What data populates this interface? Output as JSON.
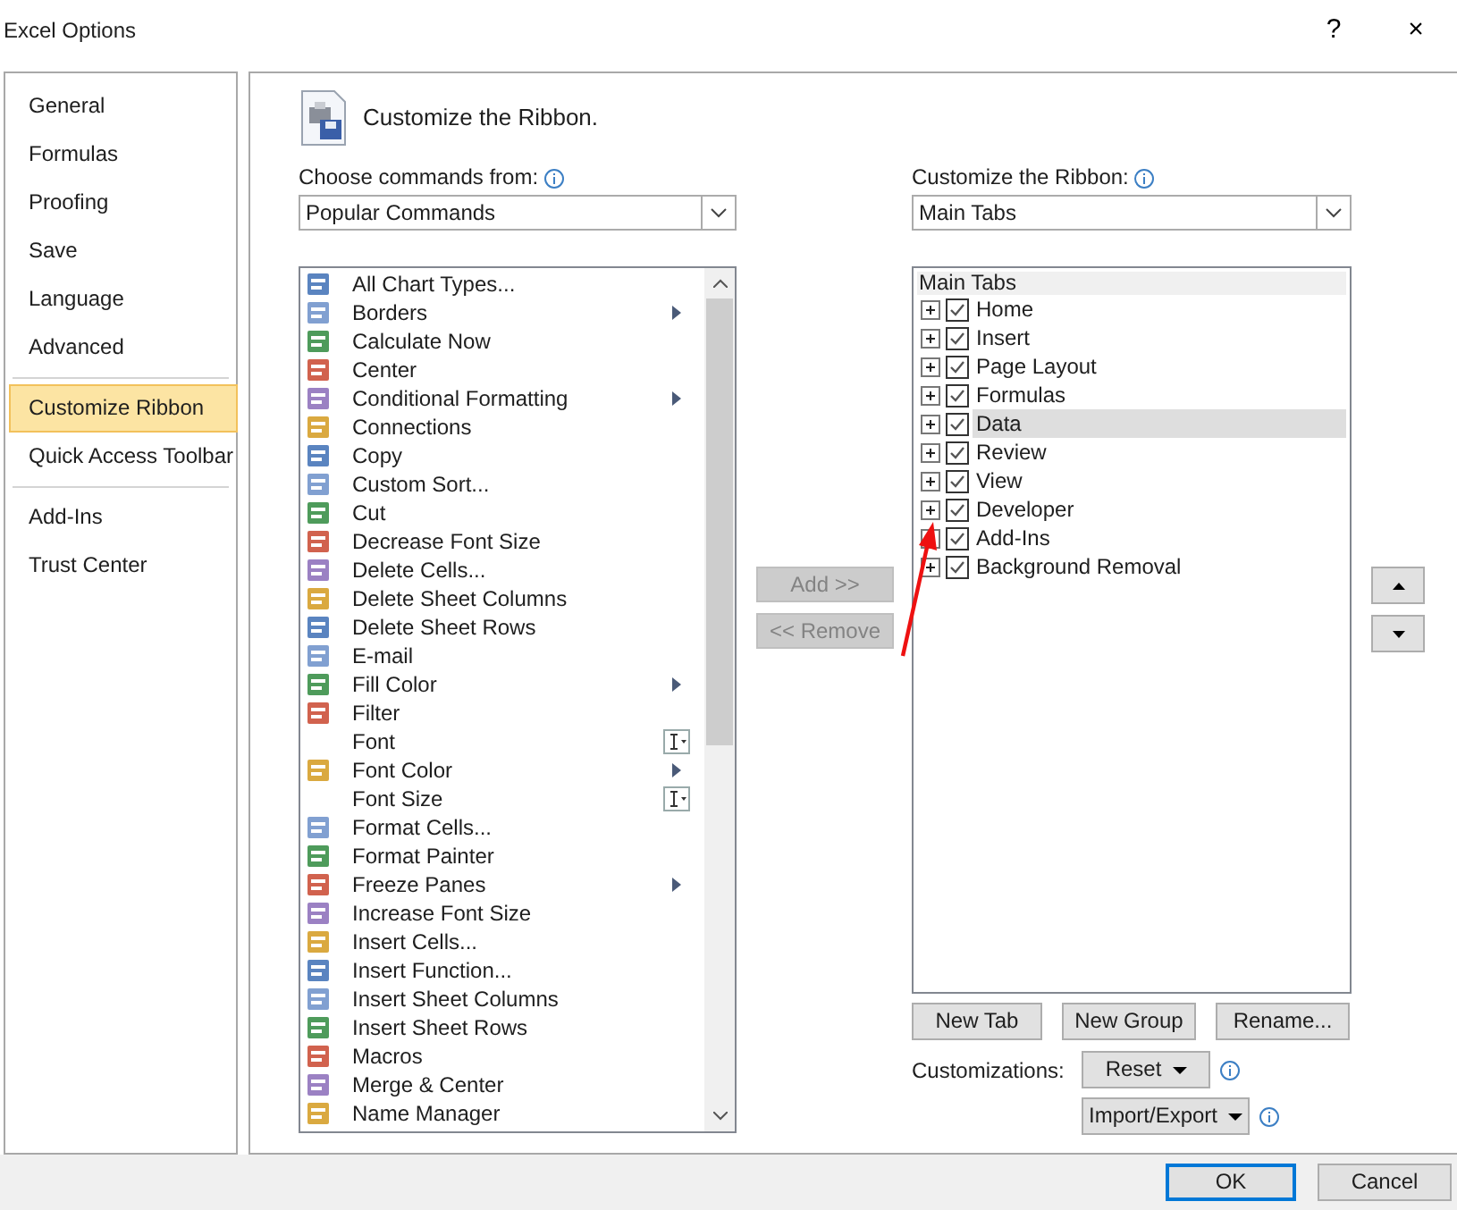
{
  "window": {
    "title": "Excel Options",
    "help": "?",
    "close": "×"
  },
  "sidebar": {
    "groups": [
      [
        {
          "label": "General",
          "selected": false
        },
        {
          "label": "Formulas",
          "selected": false
        },
        {
          "label": "Proofing",
          "selected": false
        },
        {
          "label": "Save",
          "selected": false
        },
        {
          "label": "Language",
          "selected": false
        },
        {
          "label": "Advanced",
          "selected": false
        }
      ],
      [
        {
          "label": "Customize Ribbon",
          "selected": true
        },
        {
          "label": "Quick Access Toolbar",
          "selected": false
        }
      ],
      [
        {
          "label": "Add-Ins",
          "selected": false
        },
        {
          "label": "Trust Center",
          "selected": false
        }
      ]
    ]
  },
  "header": {
    "title": "Customize the Ribbon."
  },
  "commands": {
    "label": "Choose commands from:",
    "value": "Popular Commands",
    "items": [
      {
        "label": "All Chart Types...",
        "kind": "plain",
        "icon": true
      },
      {
        "label": "Borders",
        "kind": "submenu",
        "icon": true
      },
      {
        "label": "Calculate Now",
        "kind": "plain",
        "icon": true
      },
      {
        "label": "Center",
        "kind": "plain",
        "icon": true
      },
      {
        "label": "Conditional Formatting",
        "kind": "submenu",
        "icon": true
      },
      {
        "label": "Connections",
        "kind": "plain",
        "icon": true
      },
      {
        "label": "Copy",
        "kind": "plain",
        "icon": true
      },
      {
        "label": "Custom Sort...",
        "kind": "plain",
        "icon": true
      },
      {
        "label": "Cut",
        "kind": "plain",
        "icon": true
      },
      {
        "label": "Decrease Font Size",
        "kind": "plain",
        "icon": true
      },
      {
        "label": "Delete Cells...",
        "kind": "plain",
        "icon": true
      },
      {
        "label": "Delete Sheet Columns",
        "kind": "plain",
        "icon": true
      },
      {
        "label": "Delete Sheet Rows",
        "kind": "plain",
        "icon": true
      },
      {
        "label": "E-mail",
        "kind": "plain",
        "icon": true
      },
      {
        "label": "Fill Color",
        "kind": "submenu",
        "icon": true
      },
      {
        "label": "Filter",
        "kind": "plain",
        "icon": true
      },
      {
        "label": "Font",
        "kind": "combo",
        "icon": false
      },
      {
        "label": "Font Color",
        "kind": "submenu",
        "icon": true
      },
      {
        "label": "Font Size",
        "kind": "combo",
        "icon": false
      },
      {
        "label": "Format Cells...",
        "kind": "plain",
        "icon": true
      },
      {
        "label": "Format Painter",
        "kind": "plain",
        "icon": true
      },
      {
        "label": "Freeze Panes",
        "kind": "submenu",
        "icon": true
      },
      {
        "label": "Increase Font Size",
        "kind": "plain",
        "icon": true
      },
      {
        "label": "Insert Cells...",
        "kind": "plain",
        "icon": true
      },
      {
        "label": "Insert Function...",
        "kind": "plain",
        "icon": true
      },
      {
        "label": "Insert Sheet Columns",
        "kind": "plain",
        "icon": true
      },
      {
        "label": "Insert Sheet Rows",
        "kind": "plain",
        "icon": true
      },
      {
        "label": "Macros",
        "kind": "plain",
        "icon": true
      },
      {
        "label": "Merge & Center",
        "kind": "plain",
        "icon": true
      },
      {
        "label": "Name Manager",
        "kind": "plain",
        "icon": true
      }
    ]
  },
  "middle_buttons": [
    {
      "label": "Add >>",
      "disabled": true
    },
    {
      "label": "<< Remove",
      "disabled": true
    }
  ],
  "ribbon": {
    "label": "Customize the Ribbon:",
    "value": "Main Tabs",
    "heading": "Main Tabs",
    "items": [
      {
        "label": "Home",
        "checked": true,
        "selected": false
      },
      {
        "label": "Insert",
        "checked": true,
        "selected": false
      },
      {
        "label": "Page Layout",
        "checked": true,
        "selected": false
      },
      {
        "label": "Formulas",
        "checked": true,
        "selected": false
      },
      {
        "label": "Data",
        "checked": true,
        "selected": true
      },
      {
        "label": "Review",
        "checked": true,
        "selected": false
      },
      {
        "label": "View",
        "checked": true,
        "selected": false
      },
      {
        "label": "Developer",
        "checked": true,
        "selected": false
      },
      {
        "label": "Add-Ins",
        "checked": true,
        "selected": false
      },
      {
        "label": "Background Removal",
        "checked": true,
        "selected": false
      }
    ]
  },
  "ribbon_buttons": [
    "New Tab",
    "New Group",
    "Rename..."
  ],
  "customizations": {
    "label": "Customizations:",
    "reset": "Reset",
    "import_export": "Import/Export"
  },
  "footer_buttons": [
    {
      "label": "OK",
      "default": true
    },
    {
      "label": "Cancel",
      "default": false
    }
  ],
  "annotation": {
    "kind": "arrow",
    "color": "#ee1111"
  }
}
